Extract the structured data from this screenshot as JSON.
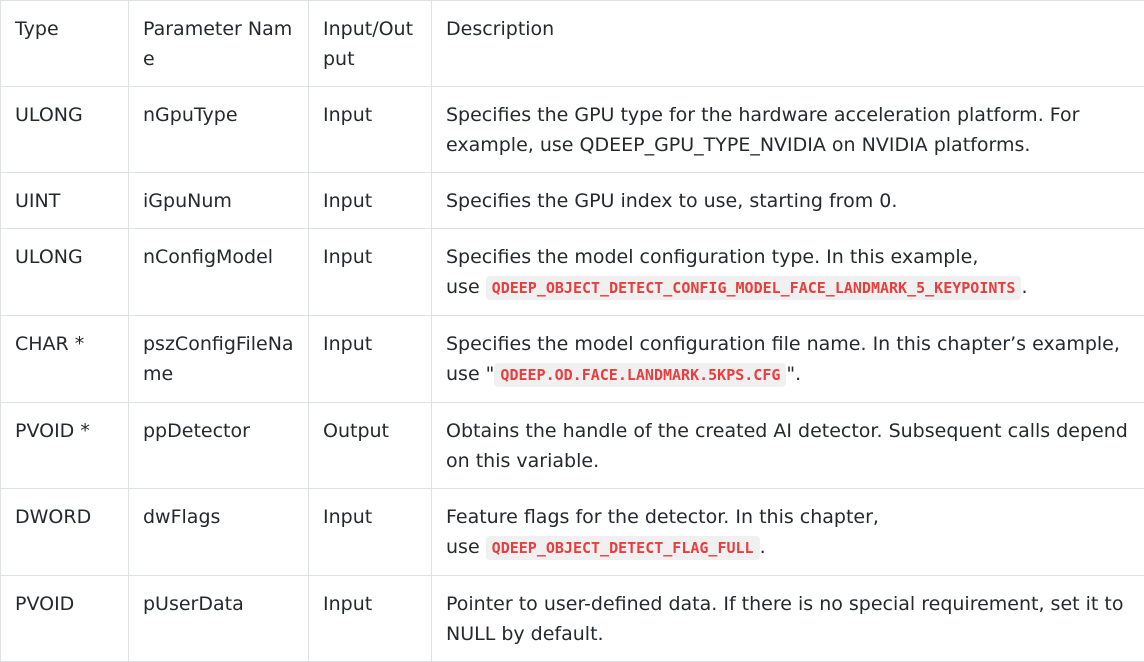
{
  "headers": {
    "type": "Type",
    "param": "Parameter Name",
    "io": "Input/Output",
    "desc": "Description"
  },
  "rows": [
    {
      "type": "ULONG",
      "param": "nGpuType",
      "io": "Input",
      "desc": "Specifies the GPU type for the hardware acceleration platform. For example, use QDEEP_GPU_TYPE_NVIDIA on NVIDIA platforms."
    },
    {
      "type": "UINT",
      "param": "iGpuNum",
      "io": "Input",
      "desc": "Specifies the GPU index to use, starting from 0."
    },
    {
      "type": "ULONG",
      "param": "nConfigModel",
      "io": "Input",
      "desc_pre": "Specifies the model configuration type. In this example,",
      "desc_mid": "use ",
      "code": "QDEEP_OBJECT_DETECT_CONFIG_MODEL_FACE_LANDMARK_5_KEYPOINTS",
      "desc_post": "."
    },
    {
      "type": "CHAR *",
      "param": "pszConfigFileName",
      "io": "Input",
      "desc_pre": "Specifies the model configuration file name. In this chapter’s example, use \"",
      "code": "QDEEP.OD.FACE.LANDMARK.5KPS.CFG",
      "desc_post": "\"."
    },
    {
      "type": "PVOID *",
      "param": "ppDetector",
      "io": "Output",
      "desc": "Obtains the handle of the created AI detector. Subsequent calls depend on this variable."
    },
    {
      "type": "DWORD",
      "param": "dwFlags",
      "io": "Input",
      "desc_pre": "Feature flags for the detector. In this chapter,",
      "desc_mid": "use ",
      "code": "QDEEP_OBJECT_DETECT_FLAG_FULL",
      "desc_post": "."
    },
    {
      "type": "PVOID",
      "param": "pUserData",
      "io": "Input",
      "desc": "Pointer to user-defined data. If there is no special requirement, set it to NULL by default."
    }
  ]
}
